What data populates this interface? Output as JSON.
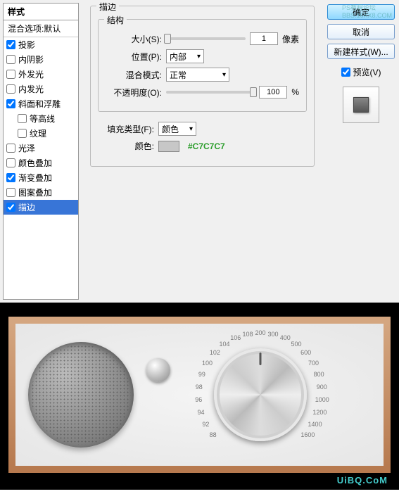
{
  "styles_panel": {
    "header": "样式",
    "blend_default": "混合选项:默认",
    "items": [
      {
        "label": "投影",
        "checked": true,
        "indent": false
      },
      {
        "label": "内阴影",
        "checked": false,
        "indent": false
      },
      {
        "label": "外发光",
        "checked": false,
        "indent": false
      },
      {
        "label": "内发光",
        "checked": false,
        "indent": false
      },
      {
        "label": "斜面和浮雕",
        "checked": true,
        "indent": false
      },
      {
        "label": "等高线",
        "checked": false,
        "indent": true
      },
      {
        "label": "纹理",
        "checked": false,
        "indent": true
      },
      {
        "label": "光泽",
        "checked": false,
        "indent": false
      },
      {
        "label": "颜色叠加",
        "checked": false,
        "indent": false
      },
      {
        "label": "渐变叠加",
        "checked": true,
        "indent": false
      },
      {
        "label": "图案叠加",
        "checked": false,
        "indent": false
      },
      {
        "label": "描边",
        "checked": true,
        "indent": false,
        "selected": true
      }
    ]
  },
  "stroke": {
    "group_label": "描边",
    "structure_label": "结构",
    "size_label": "大小(S):",
    "size_value": "1",
    "size_unit": "像素",
    "position_label": "位置(P):",
    "position_value": "内部",
    "blend_label": "混合模式:",
    "blend_value": "正常",
    "opacity_label": "不透明度(O):",
    "opacity_value": "100",
    "opacity_unit": "%",
    "filltype_label": "填充类型(F):",
    "filltype_value": "颜色",
    "color_label": "颜色:",
    "color_hex": "#C7C7C7"
  },
  "buttons": {
    "ok": "确定",
    "cancel": "取消",
    "new_style": "新建样式(W)...",
    "preview": "预览(V)"
  },
  "watermarks": {
    "top": "PS教程论坛",
    "top_url": "BBS.16XX8.COM",
    "bottom": "UiBQ.CoM"
  },
  "dial_ticks": [
    "88",
    "92",
    "94",
    "96",
    "98",
    "99",
    "100",
    "102",
    "104",
    "106",
    "108",
    "200",
    "300",
    "400",
    "500",
    "600",
    "700",
    "800",
    "900",
    "1000",
    "1200",
    "1400",
    "1600"
  ]
}
